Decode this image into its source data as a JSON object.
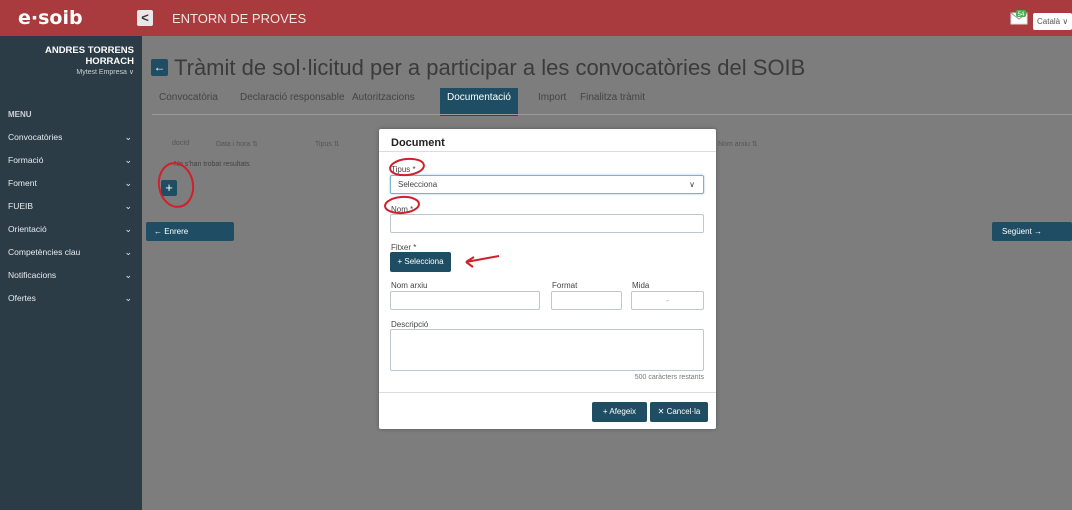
{
  "app": {
    "logo": "e·soib",
    "collapse_icon": "<",
    "environment": "ENTORN DE PROVES",
    "language": "Català ∨",
    "messages_badge": "54"
  },
  "user": {
    "name_line1": "ANDRES TORRENS",
    "name_line2": "HORRACH",
    "company": "Mytest Empresa ∨"
  },
  "menu": {
    "title": "MENU",
    "items": [
      {
        "label": "Convocatòries"
      },
      {
        "label": "Formació"
      },
      {
        "label": "Foment"
      },
      {
        "label": "FUEIB"
      },
      {
        "label": "Orientació"
      },
      {
        "label": "Competències clau"
      },
      {
        "label": "Notificacions"
      },
      {
        "label": "Ofertes"
      }
    ],
    "chevron": "⌄"
  },
  "page": {
    "back_icon": "←",
    "title": "Tràmit de sol·licitud per a participar a les convocatòries del SOIB",
    "tabs": [
      {
        "label": "Convocatòria"
      },
      {
        "label": "Declaració responsable"
      },
      {
        "label": "Autoritzacions"
      },
      {
        "label": "Documentació"
      },
      {
        "label": "Import"
      },
      {
        "label": "Finalitza tràmit"
      }
    ],
    "active_tab": "Documentació",
    "table": {
      "headers": [
        "docId",
        "Data i hora ⇅",
        "Tipus ⇅",
        "Nom arxiu ⇅"
      ],
      "empty": "No s'han trobat resultats"
    },
    "add_label": "+",
    "prev_label": "←    Enrere",
    "next_label": "Següent    →"
  },
  "modal": {
    "title": "Document",
    "tipus_label": "Tipus *",
    "tipus_value": "Selecciona",
    "nom_label": "Nom *",
    "nom_value": "",
    "fitxer_label": "Fitxer *",
    "fitxer_button": "+ Selecciona",
    "nom_arxiu_label": "Nom arxiu",
    "format_label": "Format",
    "mida_label": "Mida",
    "mida_value": "-",
    "descripcio_label": "Descripció",
    "remaining": "500 caràcters restants",
    "add_button": "+  Afegeix",
    "cancel_button": "✕  Cancel·la"
  }
}
